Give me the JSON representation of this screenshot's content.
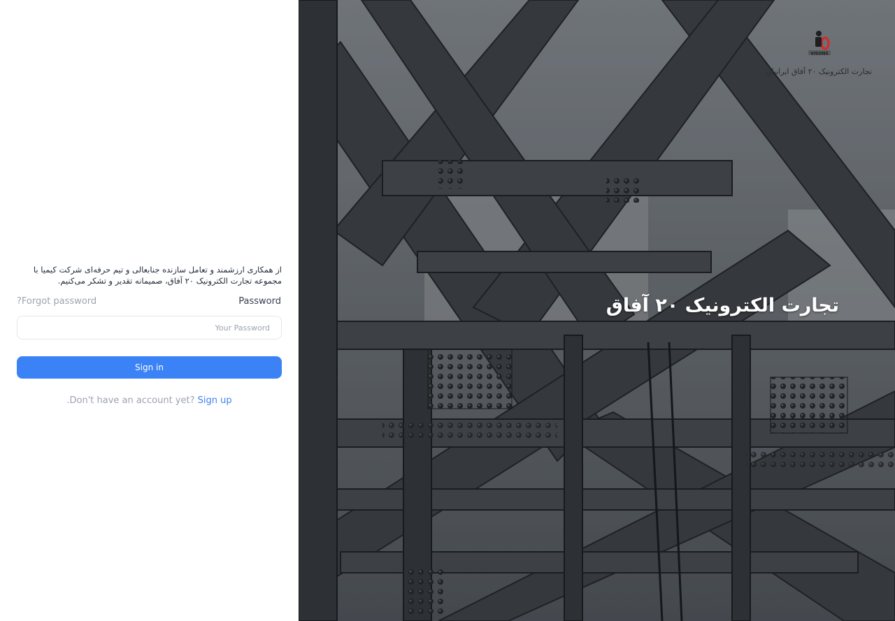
{
  "welcome_text": "از همکاری ارزشمند و تعامل سازنده جنابعالی و تیم حرفه‌ای شرکت کیمیا با مجموعه تجارت الکترونیک ۲۰ آفاق، صمیمانه تقدیر و تشکر می‌کنیم.",
  "form": {
    "password_label": "Password",
    "forgot_password": "?Forgot password",
    "password_placeholder": "Your Password",
    "signin_label": "Sign in",
    "signup_prompt": ".Don't have an account yet?",
    "signup_link": "Sign up"
  },
  "hero": {
    "title": "تجارت الکترونیک ۲۰ آفاق",
    "logo_caption": "تجارت الکترونیک ۲۰ آفاق ایرانیان",
    "logo_text": "VISONS"
  },
  "colors": {
    "accent": "#3b82f6",
    "logo_red": "#d62828"
  }
}
